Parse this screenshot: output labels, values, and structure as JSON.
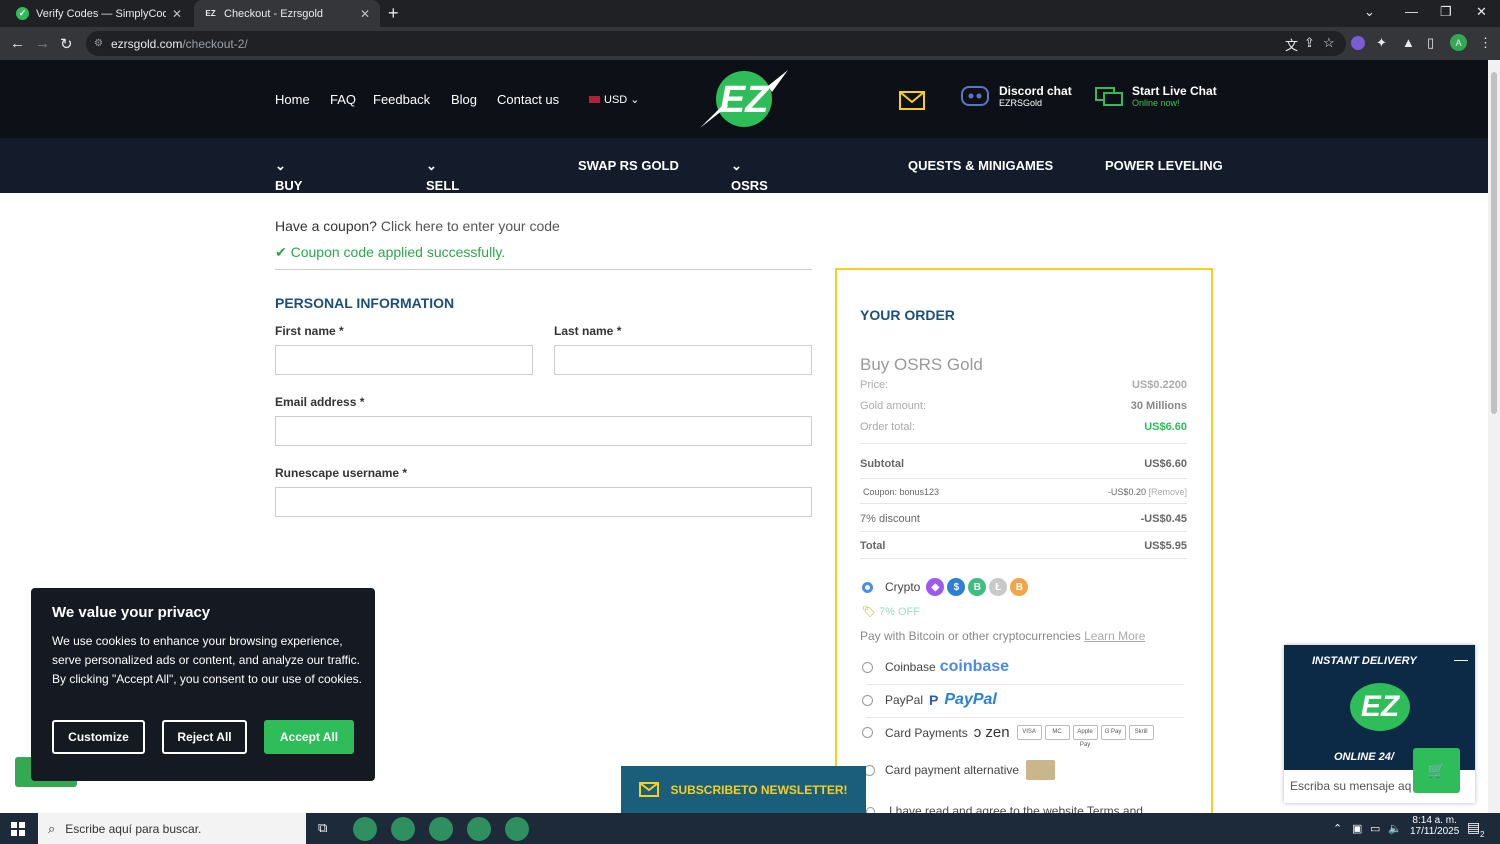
{
  "browser": {
    "tabs": [
      {
        "title": "Verify Codes — SimplyCodes"
      },
      {
        "title": "Checkout - Ezrsgold"
      }
    ],
    "url_host": "ezrsgold.com",
    "url_path": "/checkout-2/",
    "profile_initial": "A"
  },
  "header": {
    "nav": [
      "Home",
      "FAQ",
      "Feedback",
      "Blog",
      "Contact us"
    ],
    "currency": "USD",
    "logo_text": "EZ",
    "discord_title": "Discord chat",
    "discord_sub": "EZRSGold",
    "live_title": "Start Live Chat",
    "live_sub": "Online now!"
  },
  "main_nav": [
    "BUY RS GOLD",
    "SELL RS GOLD",
    "SWAP RS GOLD",
    "OSRS ACCOUNTS",
    "QUESTS & MINIGAMES",
    "POWER LEVELING"
  ],
  "coupon": {
    "question": "Have a coupon?",
    "link": "Click here to enter your code",
    "applied": "Coupon code applied successfully."
  },
  "personal": {
    "title": "PERSONAL INFORMATION",
    "first_name": "First name *",
    "last_name": "Last name *",
    "email": "Email address *",
    "username": "Runescape username *"
  },
  "order": {
    "title": "YOUR ORDER",
    "product": "Buy OSRS Gold",
    "price_label": "Price:",
    "price": "US$0.2200",
    "amount_label": "Gold amount:",
    "amount": "30 Millions",
    "order_total_label": "Order total:",
    "order_total": "US$6.60",
    "subtotal_label": "Subtotal",
    "subtotal": "US$6.60",
    "coupon_label": "Coupon: bonus123",
    "coupon_value": "-US$0.20",
    "coupon_remove": "[Remove]",
    "discount_label": "7% discount",
    "discount": "-US$0.45",
    "total_label": "Total",
    "total": "US$5.95"
  },
  "payment": {
    "crypto": "Crypto",
    "crypto_off": "7% OFF",
    "crypto_desc": "Pay with Bitcoin or other cryptocurrencies",
    "learn_more": "Learn More",
    "coinbase": "Coinbase",
    "coinbase_logo": "coinbase",
    "paypal": "PayPal",
    "paypal_logo": "PayPal",
    "card": "Card Payments",
    "zen": "zen",
    "card_brands": [
      "VISA",
      "MC",
      "Apple Pay",
      "G Pay",
      "Skrill"
    ],
    "card_alt": "Card payment alternative",
    "terms": "I have read and agree to the website Terms and"
  },
  "cookie": {
    "title": "We value your privacy",
    "text": "We use cookies to enhance your browsing experience, serve personalized ads or content, and analyze our traffic. By clicking \"Accept All\", you consent to our use of cookies.",
    "customize": "Customize",
    "reject": "Reject All",
    "accept": "Accept All"
  },
  "newsletter": "SUBSCRIBETO NEWSLETTER!",
  "chat": {
    "banner_top": "INSTANT DELIVERY",
    "banner_bottom": "ONLINE 24/",
    "placeholder": "Escriba su mensaje aq"
  },
  "taskbar": {
    "search": "Escribe aquí para buscar.",
    "time": "8:14 a. m.",
    "date": "17/11/2025",
    "notif_count": "2"
  }
}
